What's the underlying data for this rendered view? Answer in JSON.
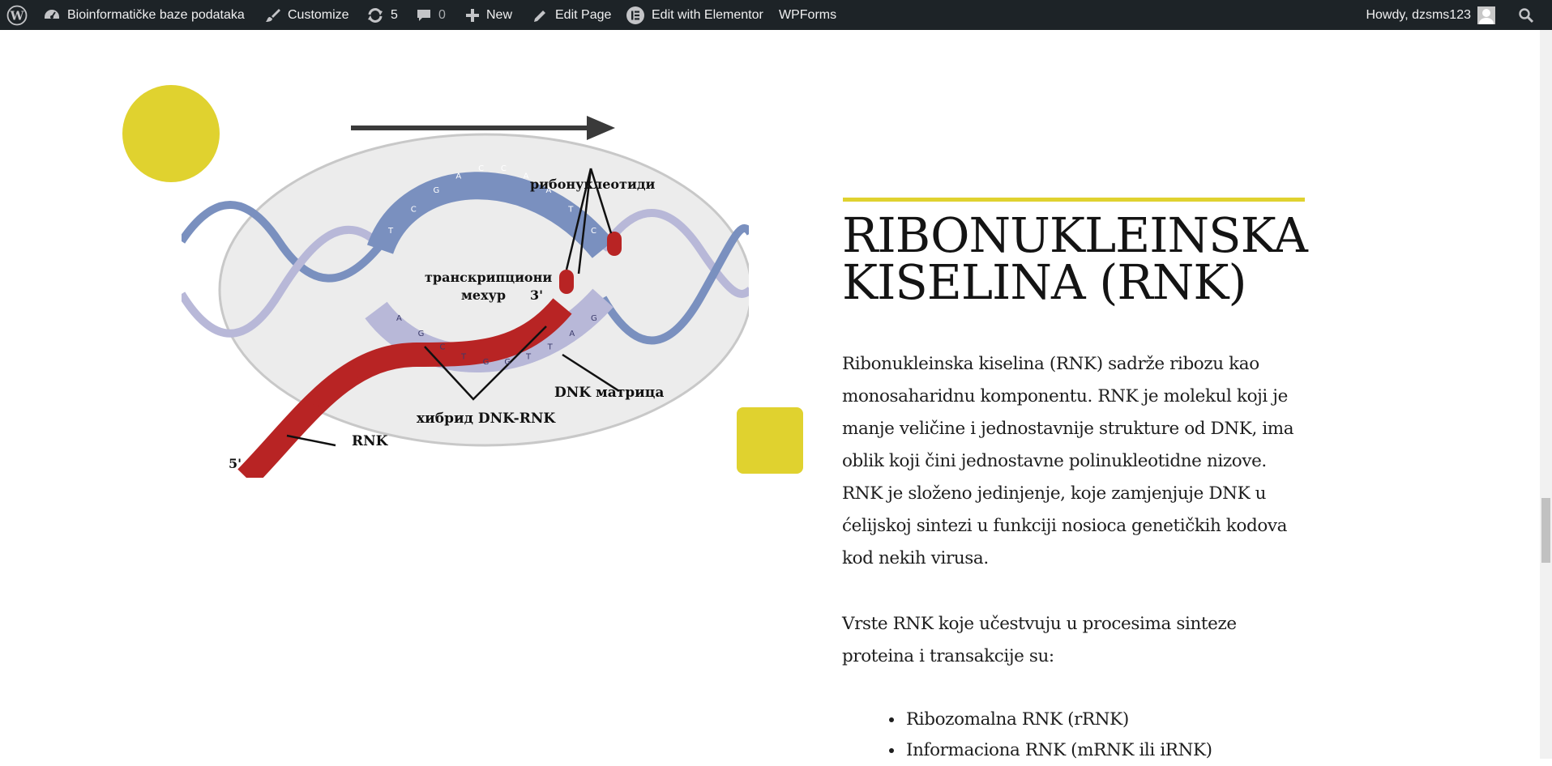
{
  "admin_bar": {
    "site_name": "Bioinformatičke baze podataka",
    "customize": "Customize",
    "updates_count": "5",
    "comments_count": "0",
    "new_label": "New",
    "edit_page": "Edit Page",
    "elementor": "Edit with Elementor",
    "wpforms": "WPForms",
    "howdy": "Howdy, dzsms123"
  },
  "figure": {
    "labels": {
      "ribonucleotides": "рибонуклеотиди",
      "bubble_line1": "транскрипциони",
      "bubble_line2": "мехур",
      "three_prime": "3'",
      "five_prime": "5'",
      "dna_template": "DNK матрица",
      "hybrid": "хибрид DNK-RNK",
      "rna": "RNK"
    },
    "bases_top": [
      "T",
      "C",
      "G",
      "A",
      "C",
      "C",
      "A",
      "A",
      "T",
      "C"
    ],
    "bases_bottom": [
      "A",
      "G",
      "C",
      "T",
      "G",
      "G",
      "T",
      "T",
      "A",
      "G"
    ]
  },
  "article": {
    "heading": "RIBONUKLEINSKA KISELINA (RNK)",
    "paragraph1": "Ribonukleinska kiselina (RNK) sadrže ribozu kao monosaharidnu komponentu. RNK je molekul koji je manje veličine i jednostavnije strukture od DNK, ima oblik koji čini jednostavne polinukleotidne nizove. RNK je složeno jedinjenje, koje zamjenjuje DNK u ćelijskoj sintezi u funkciji nosioca genetičkih kodova kod nekih virusa.",
    "paragraph2": "Vrste RNK koje učestvuju u procesima sinteze proteina i transakcije su:",
    "rna_types": [
      "Ribozomalna RNK (rRNK)",
      "Informaciona RNK (mRNK ili iRNK)"
    ]
  },
  "colors": {
    "accent_yellow": "#e0d22f",
    "admin_bar_bg": "#1d2327",
    "dna_blue": "#6b82b3",
    "dna_light": "#b3b3d6",
    "rna_red": "#b82424"
  }
}
